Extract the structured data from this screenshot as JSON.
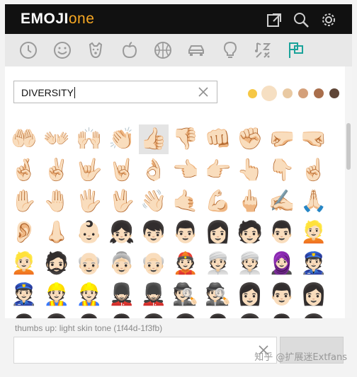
{
  "app": {
    "logo_main": "EMOJI",
    "logo_accent": "one"
  },
  "top_icons": [
    "popout-icon",
    "search-icon",
    "gear-icon"
  ],
  "categories": [
    "clock-icon",
    "smiley-icon",
    "dog-icon",
    "apple-icon",
    "basketball-icon",
    "car-icon",
    "lightbulb-icon",
    "symbols-icon",
    "flags-icon"
  ],
  "search": {
    "value": "DIVERSITY"
  },
  "skin_tones": [
    "#f6c744",
    "#f6dfc2",
    "#e9c9a2",
    "#d4a07a",
    "#a96e4b",
    "#5f4637"
  ],
  "emoji_grid": [
    [
      "🤲🏻",
      "👐🏻",
      "🙌🏻",
      "👏🏻",
      "👍🏻",
      "👎🏻",
      "👊🏻",
      "✊🏻",
      "🤛🏻",
      "🤜🏻"
    ],
    [
      "🤞🏻",
      "✌🏻",
      "🤟🏻",
      "🤘🏻",
      "👌🏻",
      "👈🏻",
      "👉🏻",
      "👆🏻",
      "👇🏻",
      "☝🏻"
    ],
    [
      "✋🏻",
      "🤚🏻",
      "🖐🏻",
      "🖖🏻",
      "👋🏻",
      "🤙🏻",
      "💪🏻",
      "🖕🏻",
      "✍🏻",
      "🙏🏻"
    ],
    [
      "👂🏻",
      "👃🏻",
      "👶🏻",
      "👧🏻",
      "👦🏻",
      "👨🏻",
      "👩🏻",
      "🧑🏻",
      "👨🏻",
      "👱🏻"
    ],
    [
      "👱🏻",
      "🧔🏻",
      "👴🏻",
      "👵🏻",
      "👴🏻",
      "👲🏻",
      "👳🏻",
      "👳🏻",
      "🧕🏻",
      "👮🏻"
    ],
    [
      "👮🏻",
      "👷🏻",
      "👷🏻",
      "💂🏻",
      "💂🏻",
      "🕵🏻",
      "🕵🏻",
      "👩🏻",
      "👨🏻",
      "👩🏻"
    ],
    [
      "👨🏻",
      "👩🏻",
      "👨🏻",
      "👨🏻",
      "👩🏻",
      "👩🏻",
      "👨🏻",
      "👩🏻",
      "👨🏻",
      "👩🏻"
    ]
  ],
  "selected_cell": [
    0,
    4
  ],
  "status_text": "thumbs up: light skin tone (1f44d-1f3fb)",
  "output": {
    "value": ""
  },
  "watermark": "知乎 @扩展迷Extfans"
}
